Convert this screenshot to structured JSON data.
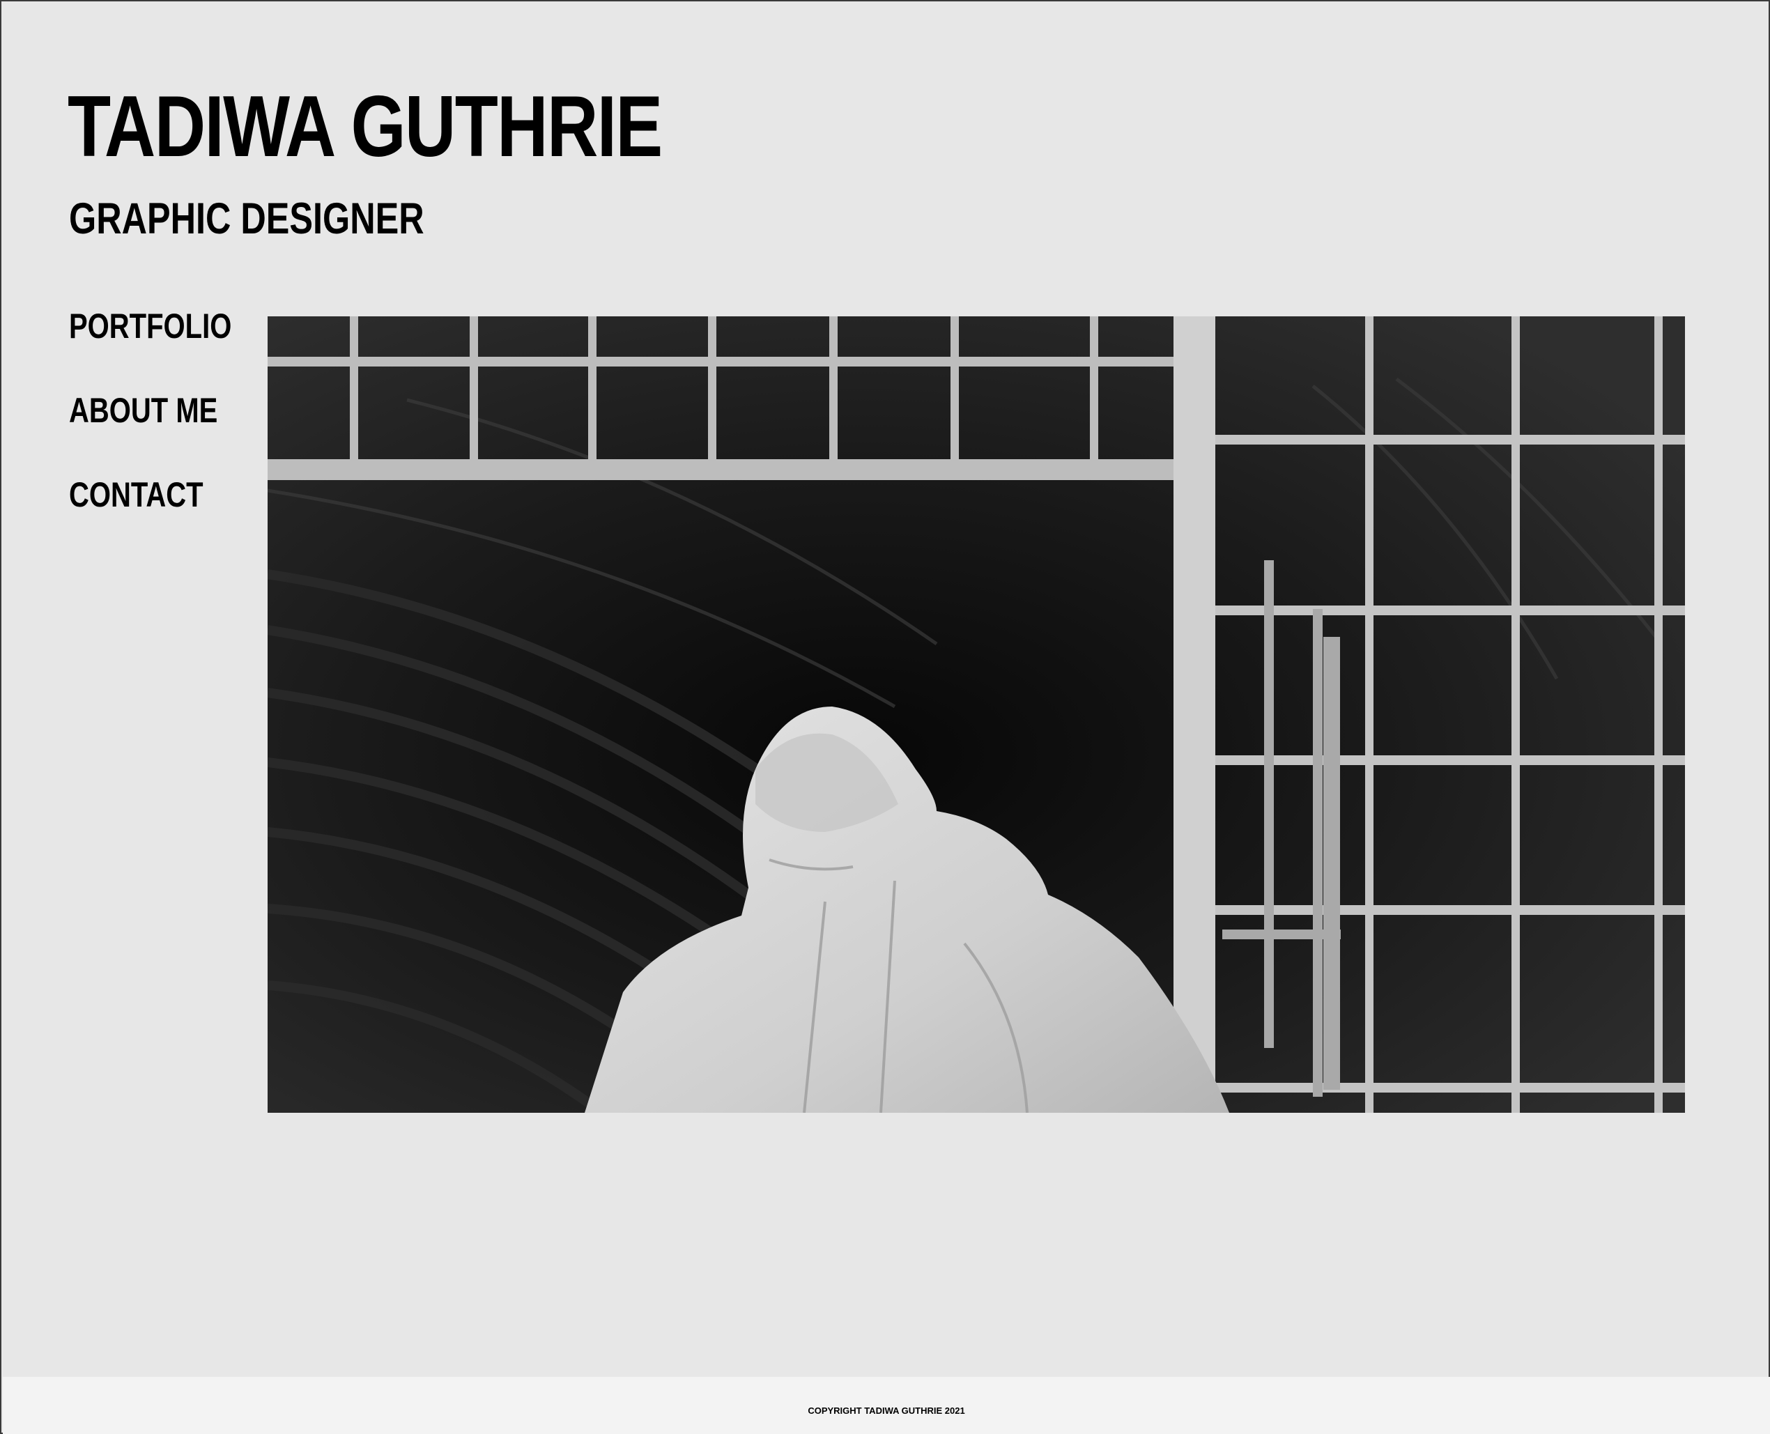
{
  "header": {
    "title": "TADIWA GUTHRIE",
    "subtitle": "GRAPHIC DESIGNER"
  },
  "nav": {
    "items": [
      {
        "label": "PORTFOLIO"
      },
      {
        "label": "ABOUT ME"
      },
      {
        "label": "CONTACT"
      }
    ]
  },
  "hero": {
    "style": "black-and-white photograph"
  },
  "footer": {
    "copyright": "COPYRIGHT TADIWA GUTHRIE 2021"
  },
  "colors": {
    "page_background": "#e7e7e7",
    "footer_background": "#f3f3f3",
    "text": "#000000"
  }
}
